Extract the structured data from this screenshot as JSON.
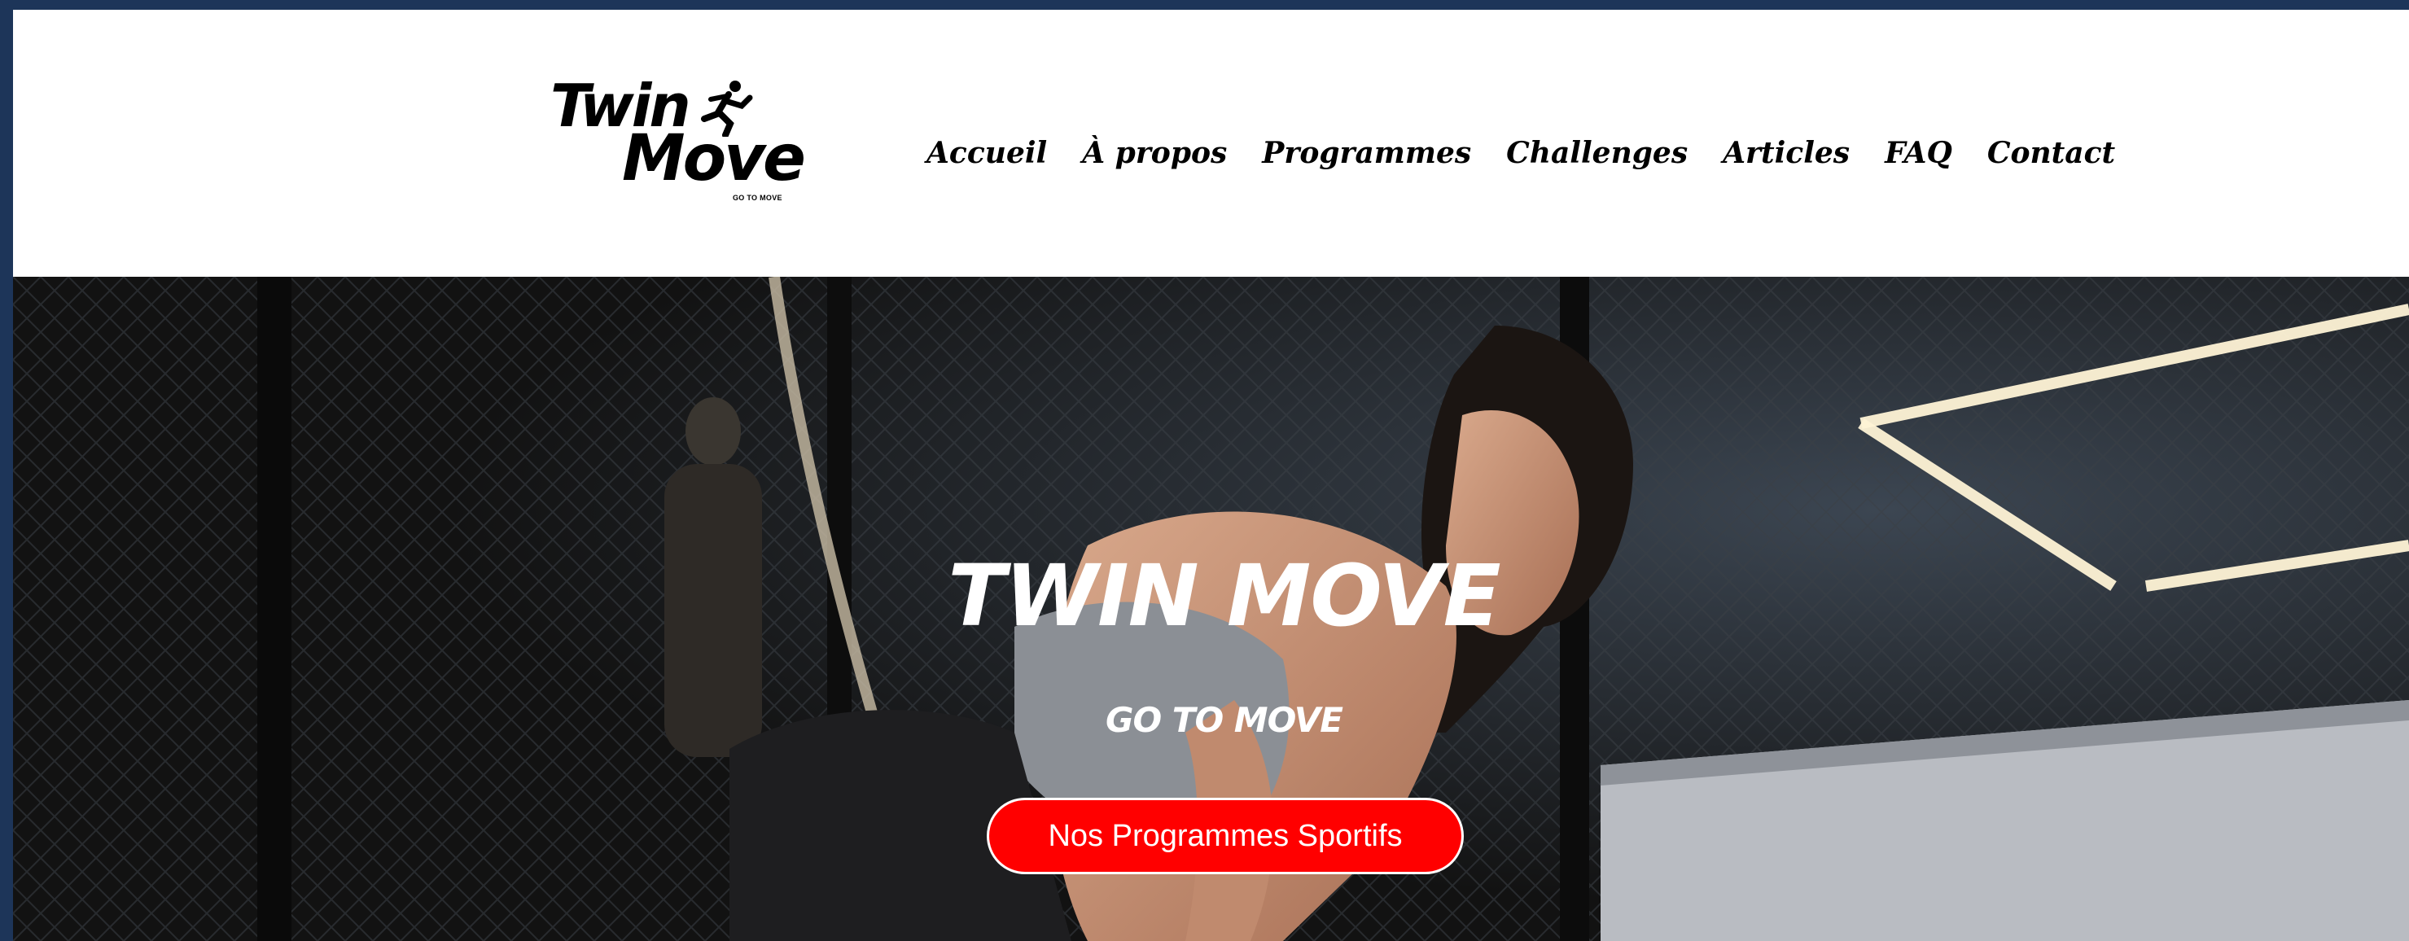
{
  "logo": {
    "line1": "Twin",
    "line2": "Move",
    "tagline": "GO TO MOVE"
  },
  "nav": {
    "items": [
      {
        "label": "Accueil"
      },
      {
        "label": "À propos"
      },
      {
        "label": "Programmes"
      },
      {
        "label": "Challenges"
      },
      {
        "label": "Articles"
      },
      {
        "label": "FAQ"
      },
      {
        "label": "Contact"
      }
    ]
  },
  "hero": {
    "title": "TWIN MOVE",
    "subtitle": "GO TO MOVE",
    "cta_label": "Nos Programmes Sportifs"
  },
  "colors": {
    "frame_background": "#1d3559",
    "header_background": "#ffffff",
    "cta_background": "#ff0000",
    "hero_text": "#ffffff"
  }
}
